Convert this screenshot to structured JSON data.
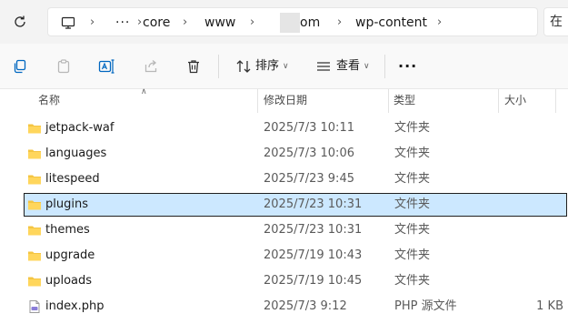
{
  "breadcrumb": {
    "items": [
      "core",
      "www",
      "om",
      "wp-content"
    ],
    "overflow": "···"
  },
  "search": {
    "text": "在"
  },
  "toolbar": {
    "sort_label": "排序",
    "view_label": "查看",
    "more": "···",
    "icons": [
      "copy-icon",
      "paste-icon",
      "rename-icon",
      "share-icon",
      "delete-icon"
    ]
  },
  "columns": {
    "name": "名称",
    "date": "修改日期",
    "type": "类型",
    "size": "大小"
  },
  "files": [
    {
      "name": "jetpack-waf",
      "date": "2025/7/3 10:11",
      "type": "文件夹",
      "size": "",
      "kind": "folder"
    },
    {
      "name": "languages",
      "date": "2025/7/3 10:06",
      "type": "文件夹",
      "size": "",
      "kind": "folder"
    },
    {
      "name": "litespeed",
      "date": "2025/7/23 9:45",
      "type": "文件夹",
      "size": "",
      "kind": "folder"
    },
    {
      "name": "plugins",
      "date": "2025/7/23 10:31",
      "type": "文件夹",
      "size": "",
      "kind": "folder",
      "selected": true
    },
    {
      "name": "themes",
      "date": "2025/7/23 10:31",
      "type": "文件夹",
      "size": "",
      "kind": "folder"
    },
    {
      "name": "upgrade",
      "date": "2025/7/19 10:43",
      "type": "文件夹",
      "size": "",
      "kind": "folder"
    },
    {
      "name": "uploads",
      "date": "2025/7/19 10:45",
      "type": "文件夹",
      "size": "",
      "kind": "folder"
    },
    {
      "name": "index.php",
      "date": "2025/7/3 9:12",
      "type": "PHP 源文件",
      "size": "1 KB",
      "kind": "php"
    }
  ],
  "colors": {
    "folder": "#f4c542",
    "selection": "#cce8ff",
    "accent_blue": "#0067c0"
  }
}
